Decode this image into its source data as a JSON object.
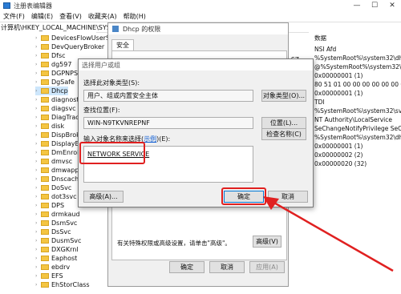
{
  "window": {
    "title": "注册表编辑器",
    "controls": [
      "—",
      "☐",
      "✕"
    ]
  },
  "menu": [
    "文件(F)",
    "编辑(E)",
    "查看(V)",
    "收藏夹(A)",
    "帮助(H)"
  ],
  "address": "计算机\\HKEY_LOCAL_MACHINE\\SYSTEM",
  "tree": {
    "items": [
      {
        "label": "DevicesFlowUserSvc",
        "selected": false
      },
      {
        "label": "DevQueryBroker",
        "selected": false
      },
      {
        "label": "Dfsc",
        "selected": false
      },
      {
        "label": "dg597",
        "selected": false
      },
      {
        "label": "DGPNPS",
        "selected": false
      },
      {
        "label": "DgSafe",
        "selected": false
      },
      {
        "label": "Dhcp",
        "selected": true
      },
      {
        "label": "diagnost",
        "selected": false
      },
      {
        "label": "diagsvc",
        "selected": false
      },
      {
        "label": "DiagTrac",
        "selected": false
      },
      {
        "label": "disk",
        "selected": false
      },
      {
        "label": "DispBrok",
        "selected": false
      },
      {
        "label": "DisplayE",
        "selected": false
      },
      {
        "label": "DmEnrol",
        "selected": false
      },
      {
        "label": "dmvsc",
        "selected": false
      },
      {
        "label": "dmwapp",
        "selected": false
      },
      {
        "label": "Dnscach",
        "selected": false
      },
      {
        "label": "DoSvc",
        "selected": false
      },
      {
        "label": "dot3svc",
        "selected": false
      },
      {
        "label": "DPS",
        "selected": false
      },
      {
        "label": "drmkaud",
        "selected": false
      },
      {
        "label": "DsmSvc",
        "selected": false
      },
      {
        "label": "DsSvc",
        "selected": false
      },
      {
        "label": "DusmSvc",
        "selected": false
      },
      {
        "label": "DXGKrnl",
        "selected": false
      },
      {
        "label": "Eaphost",
        "selected": false
      },
      {
        "label": "ebdrv",
        "selected": false
      },
      {
        "label": "EFS",
        "selected": false
      },
      {
        "label": "EhStorClass",
        "selected": false
      }
    ]
  },
  "values": {
    "header": "数据",
    "rows": [
      "NSI Afd",
      "%SystemRoot%\\system32\\dhcp",
      "@%SystemRoot%\\system32\\dhcp",
      "0x00000001 (1)",
      "80 51 01 00 00 00 00 00 00 00 00",
      "0x00000001 (1)",
      "TDI",
      "%SystemRoot%\\system32\\svchos",
      "NT Authority\\LocalService",
      "SeChangeNotifyPrivilege SeCreate",
      "%SystemRoot%\\system32\\dhcpco",
      "0x00000001 (1)",
      "0x00000002 (2)",
      "0x00000020 (32)"
    ],
    "partial_col": [
      "SZ"
    ]
  },
  "perm_dialog": {
    "title": "Dhcp 的权限",
    "tab": "安全",
    "footer_text": "有关特殊权限或高级设置，请单击\"高级\"。",
    "advanced_button": "高级(V)",
    "ok_button": "确定",
    "cancel_button": "取消",
    "apply_button": "应用(A)"
  },
  "select_dialog": {
    "title": "选择用户或组",
    "object_type_label": "选择此对象类型(S):",
    "object_type_value": "用户、组或内置安全主体",
    "object_type_button": "对象类型(O)...",
    "location_label": "查找位置(F):",
    "location_value": "WIN-N9TKVNREPNF",
    "location_button": "位置(L)...",
    "names_label": "输入对象名称来选择(示例)(E):",
    "names_link": "示例",
    "names_value": "NETWORK SERVICE",
    "check_names_button": "检查名称(C)",
    "advanced_button": "高级(A)...",
    "ok_button": "确定",
    "cancel_button": "取消"
  },
  "colors": {
    "highlight": "#e02020",
    "selection": "#cde6fb",
    "dialog_bg": "#f0f0f0"
  }
}
